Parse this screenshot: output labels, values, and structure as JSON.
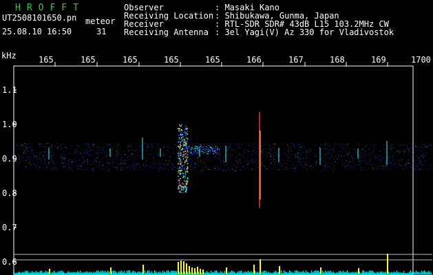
{
  "brand": "HROFFT",
  "file_name": "UT2508101650.pn",
  "tag": "meteor",
  "datetime": "25.08.10 16:50",
  "seq": "31",
  "info": {
    "observer_label": "Observer",
    "observer_value": ": Masaki Kano",
    "location_label": "Receiving Location",
    "location_value": ": Shibukawa, Gunma, Japan",
    "receiver_label": "Receiver",
    "receiver_value": ": RTL-SDR SDR# 43dB L15 103.2MHz CW",
    "antenna_label": "Receiving Antenna",
    "antenna_value": ": 3el Yagi(V) Az 330 for Vladivostok"
  },
  "axes": {
    "y_unit": "kHz",
    "y_ticks": [
      "1.1",
      "1.0",
      "0.9",
      "0.8",
      "0.7",
      "0.6"
    ],
    "x_ticks": [
      "165",
      "165",
      "165",
      "165",
      "165",
      "166",
      "167",
      "168",
      "169",
      "1700"
    ]
  },
  "colors": {
    "background": "#000000",
    "brand": "#2ecc40",
    "text": "#ffffff",
    "signal_blue": "#3050ff",
    "signal_cyan": "#30ffff",
    "signal_yellow": "#ffff30",
    "signal_red": "#ff3030",
    "amplitude_bars": "#ffff00",
    "noise_floor": "#00ffff"
  }
}
